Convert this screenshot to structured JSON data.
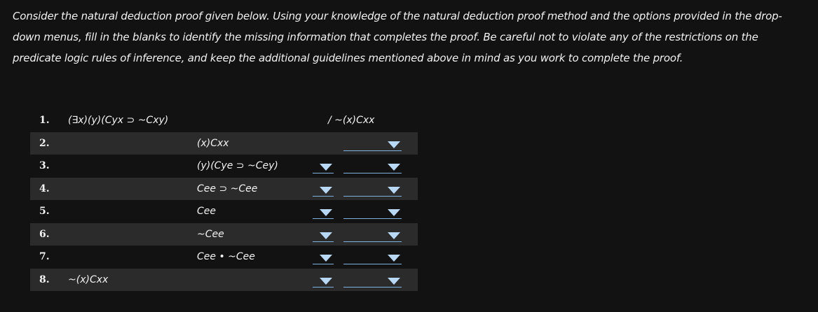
{
  "instructions": "Consider the natural deduction proof given below. Using your knowledge of the natural deduction proof method and the options provided in the drop-down menus, fill in the blanks to identify the missing information that completes the proof. Be careful not to violate any of the restrictions on the predicate logic rules of inference, and keep the additional guidelines mentioned above in mind as you work to complete the proof.",
  "proof": {
    "conclusion": "/ ~(x)Cxx",
    "lines": [
      {
        "num": "1.",
        "formula": "(∃x)(y)(Cyx ⊃ ~Cxy)"
      },
      {
        "num": "2.",
        "formula": "(x)Cxx"
      },
      {
        "num": "3.",
        "formula": "(y)(Cye ⊃ ~Cey)"
      },
      {
        "num": "4.",
        "formula": "Cee ⊃ ~Cee"
      },
      {
        "num": "5.",
        "formula": "Cee"
      },
      {
        "num": "6.",
        "formula": "~Cee"
      },
      {
        "num": "7.",
        "formula": "Cee • ~Cee"
      },
      {
        "num": "8.",
        "formula": "~(x)Cxx"
      }
    ],
    "dropdowns": {
      "line_ref_value": "",
      "rule_value": ""
    }
  },
  "icons": {
    "dropdown_arrow": "chevron-down-icon"
  },
  "colors": {
    "background": "#121212",
    "shaded_row": "#2b2b2b",
    "text": "#f2f2f2",
    "dropdown_arrow": "#b9d8f6",
    "dropdown_underline": "#7eb0e0"
  }
}
